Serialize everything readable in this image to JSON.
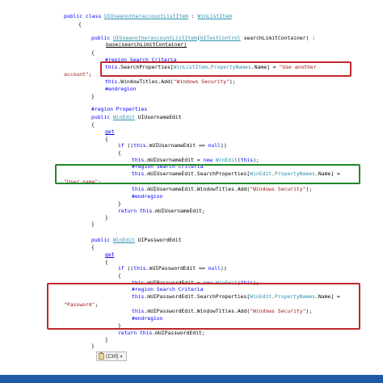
{
  "code_lines": [
    [
      {
        "t": "public class ",
        "c": "kw"
      },
      {
        "t": "UIUseanotheraccountListItem",
        "c": "ty ul"
      },
      {
        "t": " : "
      },
      {
        "t": "WinListItem",
        "c": "ty ul"
      }
    ],
    [
      {
        "t": "{"
      }
    ],
    [
      {
        "t": "public ",
        "c": "kw"
      },
      {
        "t": "UIUseanotheraccountListItem",
        "c": "ty ul"
      },
      {
        "t": "("
      },
      {
        "t": "UITestControl",
        "c": "ty ul"
      },
      {
        "t": " searchLimitContainer) :"
      }
    ],
    [
      {
        "t": "base(",
        "c": "ul"
      },
      {
        "t": "searchLimitContainer)",
        "c": "ul"
      }
    ],
    [
      {
        "t": "{"
      }
    ],
    [
      {
        "t": "#region Search Criteria",
        "c": "kw"
      }
    ],
    [
      {
        "t": "this",
        "c": "kw"
      },
      {
        "t": ".SearchProperties["
      },
      {
        "t": "WinListItem",
        "c": "ty"
      },
      {
        "t": "."
      },
      {
        "t": "PropertyNames",
        "c": "ty"
      },
      {
        "t": ".Name] = "
      },
      {
        "t": "\"Use another",
        "c": "st"
      }
    ],
    [
      {
        "t": "account\"",
        "c": "st"
      },
      {
        "t": ";"
      }
    ],
    [
      {
        "t": "this",
        "c": "kw"
      },
      {
        "t": ".WindowTitles.Add("
      },
      {
        "t": "\"Windows Security\"",
        "c": "st"
      },
      {
        "t": ");"
      }
    ],
    [
      {
        "t": "#endregion",
        "c": "kw"
      }
    ],
    [
      {
        "t": "}"
      }
    ],
    [
      {
        "t": "#region Properties",
        "c": "kw"
      }
    ],
    [
      {
        "t": "public ",
        "c": "kw"
      },
      {
        "t": "WinEdit",
        "c": "ty ul"
      },
      {
        "t": " UIUsernameEdit"
      }
    ],
    [
      {
        "t": "{"
      }
    ],
    [
      {
        "t": "get",
        "c": "kw ul"
      }
    ],
    [
      {
        "t": "{"
      }
    ],
    [
      {
        "t": "if",
        "c": "kw"
      },
      {
        "t": " (("
      },
      {
        "t": "this",
        "c": "kw"
      },
      {
        "t": ".mUIUsernameEdit == "
      },
      {
        "t": "null",
        "c": "kw"
      },
      {
        "t": "))"
      }
    ],
    [
      {
        "t": "{"
      }
    ],
    [
      {
        "t": "this",
        "c": "kw"
      },
      {
        "t": ".mUIUsernameEdit = "
      },
      {
        "t": "new ",
        "c": "kw"
      },
      {
        "t": "WinEdit",
        "c": "ty"
      },
      {
        "t": "("
      },
      {
        "t": "this",
        "c": "kw"
      },
      {
        "t": ");"
      }
    ],
    [
      {
        "t": "#region Search Criteria",
        "c": "kw"
      }
    ],
    [
      {
        "t": "this",
        "c": "kw"
      },
      {
        "t": ".mUIUsernameEdit.SearchProperties["
      },
      {
        "t": "WinEdit",
        "c": "ty"
      },
      {
        "t": "."
      },
      {
        "t": "PropertyNames",
        "c": "ty"
      },
      {
        "t": ".Name] ="
      }
    ],
    [
      {
        "t": "\"User name\"",
        "c": "st"
      },
      {
        "t": ";"
      }
    ],
    [
      {
        "t": "this",
        "c": "kw"
      },
      {
        "t": ".mUIUsernameEdit.WindowTitles.Add("
      },
      {
        "t": "\"Windows Security\"",
        "c": "st"
      },
      {
        "t": ");"
      }
    ],
    [
      {
        "t": "#endregion",
        "c": "kw"
      }
    ],
    [
      {
        "t": "}"
      }
    ],
    [
      {
        "t": "return ",
        "c": "kw"
      },
      {
        "t": "this",
        "c": "kw"
      },
      {
        "t": ".mUIUsernameEdit;"
      }
    ],
    [
      {
        "t": "}"
      }
    ],
    [
      {
        "t": "}"
      }
    ],
    [
      {
        "t": "public ",
        "c": "kw"
      },
      {
        "t": "WinEdit",
        "c": "ty ul"
      },
      {
        "t": " UIPasswordEdit"
      }
    ],
    [
      {
        "t": "{"
      }
    ],
    [
      {
        "t": "get",
        "c": "kw ul"
      }
    ],
    [
      {
        "t": "{"
      }
    ],
    [
      {
        "t": "if",
        "c": "kw"
      },
      {
        "t": " (("
      },
      {
        "t": "this",
        "c": "kw"
      },
      {
        "t": ".mUIPasswordEdit == "
      },
      {
        "t": "null",
        "c": "kw"
      },
      {
        "t": "))"
      }
    ],
    [
      {
        "t": "{"
      }
    ],
    [
      {
        "t": "this",
        "c": "kw"
      },
      {
        "t": ".mUIPasswordEdit = "
      },
      {
        "t": "new ",
        "c": "kw"
      },
      {
        "t": "WinEdit",
        "c": "ty"
      },
      {
        "t": "("
      },
      {
        "t": "this",
        "c": "kw"
      },
      {
        "t": ");"
      }
    ],
    [
      {
        "t": "#region Search Criteria",
        "c": "kw"
      }
    ],
    [
      {
        "t": "this",
        "c": "kw"
      },
      {
        "t": ".mUIPasswordEdit.SearchProperties["
      },
      {
        "t": "WinEdit",
        "c": "ty"
      },
      {
        "t": "."
      },
      {
        "t": "PropertyNames",
        "c": "ty"
      },
      {
        "t": ".Name] ="
      }
    ],
    [
      {
        "t": "\"Password\"",
        "c": "st"
      },
      {
        "t": ";"
      }
    ],
    [
      {
        "t": "this",
        "c": "kw"
      },
      {
        "t": ".mUIPasswordEdit.WindowTitles.Add("
      },
      {
        "t": "\"Windows Security\"",
        "c": "st"
      },
      {
        "t": ");"
      }
    ],
    [
      {
        "t": "#endregion",
        "c": "kw"
      }
    ],
    [
      {
        "t": "}"
      }
    ],
    [
      {
        "t": "return ",
        "c": "kw"
      },
      {
        "t": "this",
        "c": "kw"
      },
      {
        "t": ".mUIPasswordEdit;"
      }
    ],
    [
      {
        "t": "}"
      }
    ],
    [
      {
        "t": "}"
      }
    ]
  ],
  "paste_options": {
    "label": "(Ctrl)",
    "dropdown": "▾"
  },
  "colors": {
    "keyword": "#0000ff",
    "type": "#2b91af",
    "string": "#a31515",
    "highlight_red": "#c0282d",
    "highlight_green": "#1f8a2a"
  }
}
